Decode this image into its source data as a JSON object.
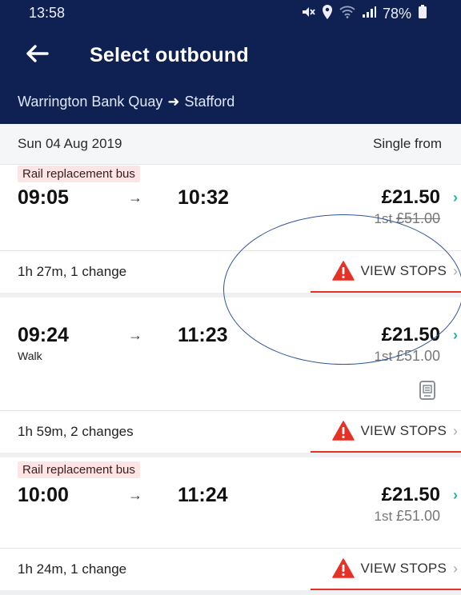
{
  "status": {
    "time": "13:58",
    "battery": "78%"
  },
  "header": {
    "title": "Select outbound",
    "route_from": "Warrington Bank Quay",
    "route_arrow": "➜",
    "route_to": "Stafford"
  },
  "date_row": {
    "date": "Sun 04 Aug 2019",
    "label": "Single from"
  },
  "journeys": [
    {
      "badge": "Rail replacement bus",
      "depart": "09:05",
      "arrive": "10:32",
      "arrow": "→",
      "price": "£21.50",
      "first_label": "1st",
      "first_price": "£51.00",
      "summary": "1h 27m, 1 change",
      "stops_label": "VIEW STOPS"
    },
    {
      "depart": "09:24",
      "arrive": "11:23",
      "arrow": "→",
      "note": "Walk",
      "price": "£21.50",
      "first_label": "1st",
      "first_price": "£51.00",
      "summary": "1h 59m, 2 changes",
      "stops_label": "VIEW STOPS"
    },
    {
      "badge": "Rail replacement bus",
      "depart": "10:00",
      "arrive": "11:24",
      "arrow": "→",
      "price": "£21.50",
      "first_label": "1st",
      "first_price": "£51.00",
      "summary": "1h 24m, 1 change",
      "stops_label": "VIEW STOPS"
    }
  ],
  "colors": {
    "header_bg": "#0f2152",
    "accent_red": "#e63127",
    "chevron_green": "#1fb79b",
    "badge_bg": "#fde5e5"
  },
  "icons": [
    "back-arrow-icon",
    "mute-icon",
    "location-icon",
    "wifi-icon",
    "signal-icon",
    "battery-icon",
    "warning-icon",
    "chevron-right-icon",
    "ticket-icon"
  ]
}
